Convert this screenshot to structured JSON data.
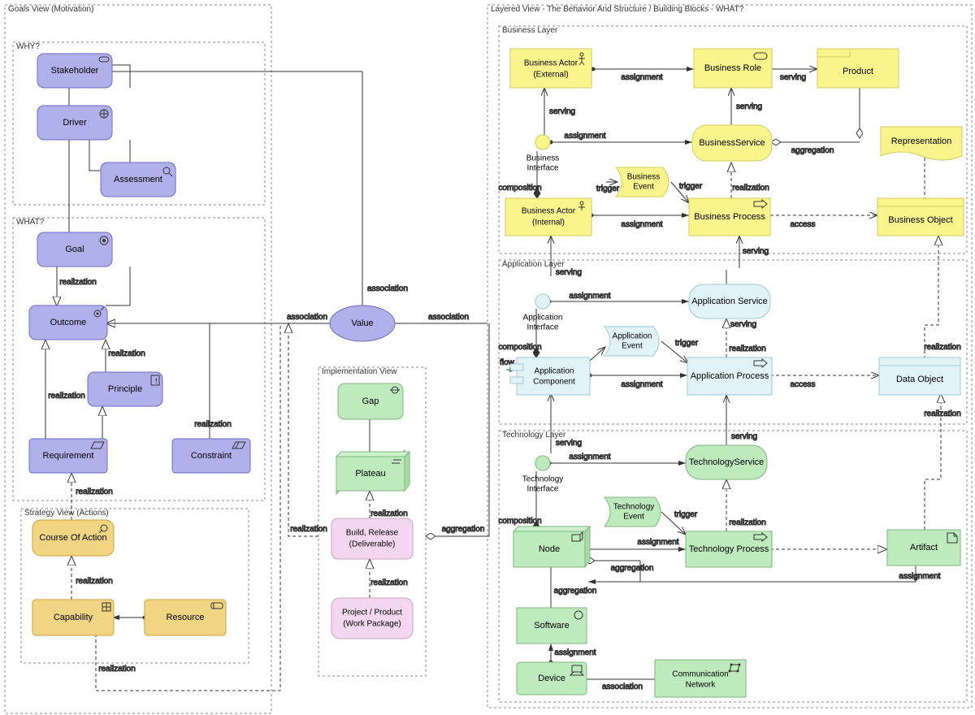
{
  "views": {
    "goals": {
      "title": "Goals View (Motivation)",
      "why": "WHY?",
      "what": "WHAT?"
    },
    "layered": {
      "title": "Layered View - The Behavior And Structure / Building Blocks - WHAT?",
      "business": "Business Layer",
      "application": "Application Layer",
      "technology": "Technology Layer"
    },
    "strategy": {
      "title": "Strategy View (Actions)"
    },
    "implementation": {
      "title": "Implementation View"
    }
  },
  "nodes": {
    "stakeholder": "Stakeholder",
    "driver": "Driver",
    "assessment": "Assessment",
    "goal": "Goal",
    "outcome": "Outcome",
    "principle": "Principle",
    "requirement": "Requirement",
    "constraint": "Constraint",
    "course": "Course Of Action",
    "capability": "Capability",
    "resource": "Resource",
    "value": "Value",
    "gap": "Gap",
    "plateau": "Plateau",
    "build1": "Build, Release",
    "build2": "(Deliverable)",
    "project1": "Project / Product",
    "project2": "(Work Package)",
    "bactorext1": "Business Actor",
    "bactorext2": "(External)",
    "brole": "Business Role",
    "product": "Product",
    "bintf1": "Business",
    "bintf2": "Interface",
    "bsvc": "BusinessService",
    "repr": "Representation",
    "bevent1": "Business",
    "bevent2": "Event",
    "bactorint1": "Business Actor",
    "bactorint2": "(Internal)",
    "bproc": "Business Process",
    "bobj": "Business Object",
    "aintf1": "Application",
    "aintf2": "Interface",
    "asvc": "Application Service",
    "aevent1": "Application",
    "aevent2": "Event",
    "acomp1": "Application",
    "acomp2": "Component",
    "aproc": "Application Process",
    "dobj": "Data Object",
    "tintf1": "Technology",
    "tintf2": "Interface",
    "tsvc": "TechnologyService",
    "tevent1": "Technology",
    "tevent2": "Event",
    "node": "Node",
    "tproc": "Technology Process",
    "artifact": "Artifact",
    "software": "Software",
    "device": "Device",
    "comm1": "Communication",
    "comm2": "Network"
  },
  "edges": {
    "assoc": "association",
    "realiz": "realization",
    "assign": "assignment",
    "serve": "serving",
    "aggr": "aggregation",
    "comp": "composition",
    "trig": "trigger",
    "access": "access",
    "flow": "flow"
  },
  "colors": {
    "motivation": "#B0B0EB",
    "mot_stroke": "#6b6bc0",
    "strategy": "#F2D582",
    "str_stroke": "#c9a33a",
    "impl_green": "#BDEBBD",
    "impl_pink": "#F5D6F0",
    "impl_stroke": "#7fb77f",
    "pink_stroke": "#caa0c4",
    "business": "#FAF48C",
    "biz_stroke": "#d2cd5e",
    "application": "#E2F3F8",
    "app_stroke": "#9fc9d6",
    "technology": "#BDEBBD",
    "tech_stroke": "#7fb77f"
  }
}
